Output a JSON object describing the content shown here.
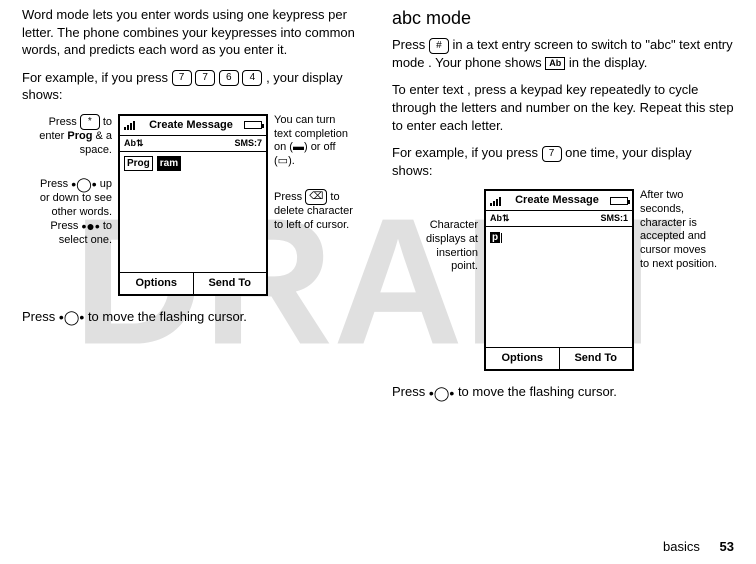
{
  "watermark": "DRAFT",
  "left": {
    "p1": "Word mode lets you enter words using one keypress per letter. The phone combines your keypresses into common words, and predicts each word as you enter it.",
    "p2_prefix": "For example, if you press ",
    "p2_keys": [
      "7",
      "7",
      "6",
      "4"
    ],
    "p2_suffix": ", your display shows:",
    "callouts_left_1_a": "Press ",
    "callouts_left_1_key": "*",
    "callouts_left_1_b": " to enter ",
    "callouts_left_1_bold": "Prog",
    "callouts_left_1_c": " & a space.",
    "callouts_left_2_a": "Press ",
    "callouts_left_2_b": " up or down to see other words. Press ",
    "callouts_left_2_c": " to select one.",
    "callouts_right_1_a": "You can turn text completion on (",
    "callouts_right_1_b": ") or off (",
    "callouts_right_1_c": ").",
    "callouts_right_2_a": "Press ",
    "callouts_right_2_key": "⌫",
    "callouts_right_2_b": " to delete character to left of cursor.",
    "phone": {
      "title": "Create Message",
      "status_left": "Ab",
      "status_right": "SMS:7",
      "word1": "Prog",
      "word2": "ram",
      "sk_left": "Options",
      "sk_right": "Send To"
    },
    "bottom": "Press ",
    "bottom2": " to move the flashing cursor."
  },
  "right": {
    "heading": "abc mode",
    "p1_a": "Press ",
    "p1_key": "#",
    "p1_b": " in a text entry screen to switch to \"abc\" text entry mode . Your phone shows ",
    "p1_ind": "Ab",
    "p1_c": " in the display.",
    "p2": "To enter text , press a keypad key repeatedly to cycle through the letters and number on the key. Repeat this step to enter each letter.",
    "p3_a": "For example, if you press ",
    "p3_key": "7",
    "p3_b": " one time, your display shows:",
    "callouts_left_1": "Character displays at insertion point.",
    "callouts_right_1": "After two seconds, character is accepted and cursor moves to next position.",
    "phone": {
      "title": "Create Message",
      "status_left": "Ab",
      "status_right": "SMS:1",
      "char": "p",
      "sk_left": "Options",
      "sk_right": "Send To"
    },
    "bottom": "Press ",
    "bottom2": " to move the flashing cursor."
  },
  "footer": {
    "section": "basics",
    "page": "53"
  }
}
